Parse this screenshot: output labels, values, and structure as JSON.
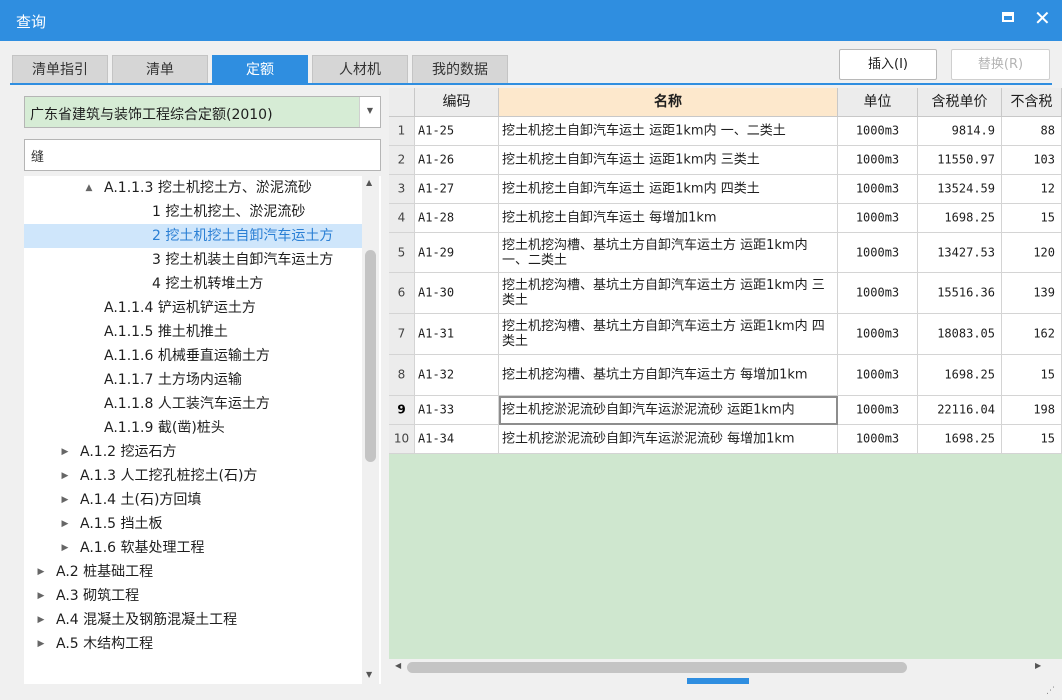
{
  "window": {
    "title": "查询",
    "accent": "#2f8ee0"
  },
  "tabs": [
    "清单指引",
    "清单",
    "定额",
    "人材机",
    "我的数据"
  ],
  "active_tab": "定额",
  "buttons": {
    "insert": "插入(I)",
    "replace": "替换(R)"
  },
  "library": {
    "selected": "广东省建筑与装饰工程综合定额(2010)"
  },
  "search": {
    "value": "缝"
  },
  "tree": [
    {
      "label": "A.1.1.3 挖土机挖土方、淤泥流砂",
      "toggle": "▲",
      "level": 3,
      "selected": false
    },
    {
      "label": "1 挖土机挖土、淤泥流砂",
      "toggle": "",
      "level": 4,
      "selected": false
    },
    {
      "label": "2 挖土机挖土自卸汽车运土方",
      "toggle": "",
      "level": 4,
      "selected": true
    },
    {
      "label": "3 挖土机装土自卸汽车运土方",
      "toggle": "",
      "level": 4,
      "selected": false
    },
    {
      "label": "4 挖土机转堆土方",
      "toggle": "",
      "level": 4,
      "selected": false
    },
    {
      "label": "A.1.1.4 铲运机铲运土方",
      "toggle": "",
      "level": 3,
      "selected": false
    },
    {
      "label": "A.1.1.5 推土机推土",
      "toggle": "",
      "level": 3,
      "selected": false
    },
    {
      "label": "A.1.1.6 机械垂直运输土方",
      "toggle": "",
      "level": 3,
      "selected": false
    },
    {
      "label": "A.1.1.7 土方场内运输",
      "toggle": "",
      "level": 3,
      "selected": false
    },
    {
      "label": "A.1.1.8 人工装汽车运土方",
      "toggle": "",
      "level": 3,
      "selected": false
    },
    {
      "label": "A.1.1.9 截(凿)桩头",
      "toggle": "",
      "level": 3,
      "selected": false
    },
    {
      "label": "A.1.2 挖运石方",
      "toggle": "▶",
      "level": 2,
      "selected": false
    },
    {
      "label": "A.1.3 人工挖孔桩挖土(石)方",
      "toggle": "▶",
      "level": 2,
      "selected": false
    },
    {
      "label": "A.1.4 土(石)方回填",
      "toggle": "▶",
      "level": 2,
      "selected": false
    },
    {
      "label": "A.1.5 挡土板",
      "toggle": "▶",
      "level": 2,
      "selected": false
    },
    {
      "label": "A.1.6 软基处理工程",
      "toggle": "▶",
      "level": 2,
      "selected": false
    },
    {
      "label": "A.2 桩基础工程",
      "toggle": "▶",
      "level": 1,
      "selected": false
    },
    {
      "label": "A.3 砌筑工程",
      "toggle": "▶",
      "level": 1,
      "selected": false
    },
    {
      "label": "A.4 混凝土及钢筋混凝土工程",
      "toggle": "▶",
      "level": 1,
      "selected": false
    },
    {
      "label": "A.5 木结构工程",
      "toggle": "▶",
      "level": 1,
      "selected": false
    }
  ],
  "grid": {
    "columns": [
      "",
      "编码",
      "名称",
      "单位",
      "含税单价",
      "不含税"
    ],
    "current_row": 9,
    "rows": [
      {
        "n": "1",
        "code": "A1-25",
        "name": "挖土机挖土自卸汽车运土 运距1km内 一、二类土",
        "unit": "1000m3",
        "price": "9814.9",
        "extax": "88"
      },
      {
        "n": "2",
        "code": "A1-26",
        "name": "挖土机挖土自卸汽车运土 运距1km内 三类土",
        "unit": "1000m3",
        "price": "11550.97",
        "extax": "103"
      },
      {
        "n": "3",
        "code": "A1-27",
        "name": "挖土机挖土自卸汽车运土 运距1km内 四类土",
        "unit": "1000m3",
        "price": "13524.59",
        "extax": "12"
      },
      {
        "n": "4",
        "code": "A1-28",
        "name": "挖土机挖土自卸汽车运土 每增加1km",
        "unit": "1000m3",
        "price": "1698.25",
        "extax": "15"
      },
      {
        "n": "5",
        "code": "A1-29",
        "name": "挖土机挖沟槽、基坑土方自卸汽车运土方 运距1km内 一、二类土",
        "unit": "1000m3",
        "price": "13427.53",
        "extax": "120"
      },
      {
        "n": "6",
        "code": "A1-30",
        "name": "挖土机挖沟槽、基坑土方自卸汽车运土方 运距1km内 三类土",
        "unit": "1000m3",
        "price": "15516.36",
        "extax": "139"
      },
      {
        "n": "7",
        "code": "A1-31",
        "name": "挖土机挖沟槽、基坑土方自卸汽车运土方 运距1km内 四类土",
        "unit": "1000m3",
        "price": "18083.05",
        "extax": "162"
      },
      {
        "n": "8",
        "code": "A1-32",
        "name": "挖土机挖沟槽、基坑土方自卸汽车运土方 每增加1km",
        "unit": "1000m3",
        "price": "1698.25",
        "extax": "15"
      },
      {
        "n": "9",
        "code": "A1-33",
        "name": "挖土机挖淤泥流砂自卸汽车运淤泥流砂 运距1km内",
        "unit": "1000m3",
        "price": "22116.04",
        "extax": "198"
      },
      {
        "n": "10",
        "code": "A1-34",
        "name": "挖土机挖淤泥流砂自卸汽车运淤泥流砂 每增加1km",
        "unit": "1000m3",
        "price": "1698.25",
        "extax": "15"
      }
    ]
  }
}
